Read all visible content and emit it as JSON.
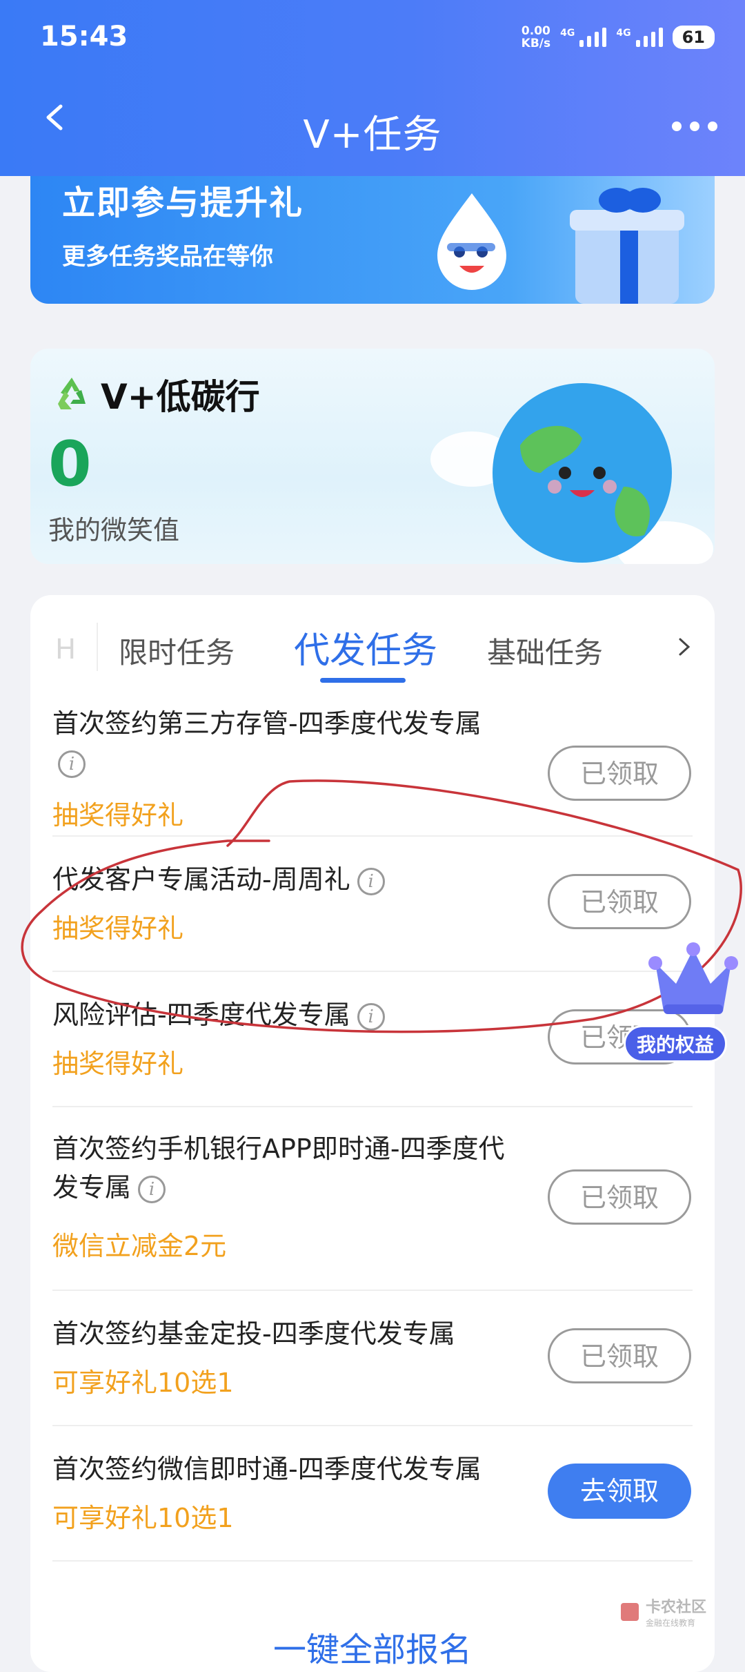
{
  "status_bar": {
    "time": "15:43",
    "net_speed_value": "0.00",
    "net_speed_unit": "KB/s",
    "sim1": "4G",
    "sim2": "4G",
    "battery": "61"
  },
  "header": {
    "title": "V+任务"
  },
  "banner": {
    "title": "立即参与提升礼",
    "subtitle": "更多任务奖品在等你"
  },
  "carbon": {
    "title": "V+低碳行",
    "smile_value": "0",
    "smile_label": "我的微笑值"
  },
  "tabs": {
    "faded": "H",
    "items": [
      "限时任务",
      "代发任务",
      "基础任务"
    ],
    "active_index": 1
  },
  "tasks": [
    {
      "title": "首次签约第三方存管-四季度代发专属",
      "reward": "抽奖得好礼",
      "button": "已领取",
      "state": "claimed"
    },
    {
      "title": "代发客户专属活动-周周礼",
      "reward": "抽奖得好礼",
      "button": "已领取",
      "state": "claimed"
    },
    {
      "title": "风险评估-四季度代发专属",
      "reward": "抽奖得好礼",
      "button": "已领取",
      "state": "claimed"
    },
    {
      "title": "首次签约手机银行APP即时通-四季度代发专属",
      "reward": "微信立减金2元",
      "button": "已领取",
      "state": "claimed"
    },
    {
      "title": "首次签约基金定投-四季度代发专属",
      "reward": "可享好礼10选1",
      "button": "已领取",
      "state": "claimed"
    },
    {
      "title": "首次签约微信即时通-四季度代发专属",
      "reward": "可享好礼10选1",
      "button": "去领取",
      "state": "available"
    }
  ],
  "footer_action": "一键全部报名",
  "floating": {
    "rights_label": "我的权益"
  },
  "watermark": {
    "line1": "卡农社区",
    "line2": "金融在线教育"
  },
  "colors": {
    "primary": "#2f6fe8",
    "reward": "#f2a11e",
    "annotation": "#c8343a",
    "smile_value": "#1aa55a"
  }
}
